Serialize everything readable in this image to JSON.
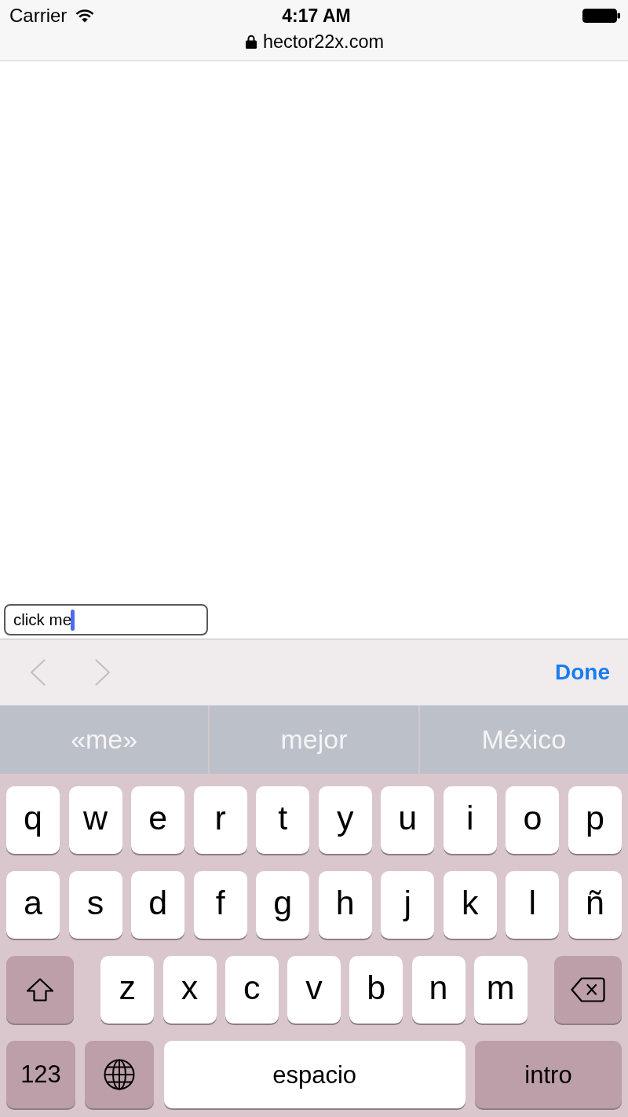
{
  "status_bar": {
    "carrier": "Carrier",
    "time": "4:17 AM"
  },
  "address_bar": {
    "secure": true,
    "url": "hector22x.com"
  },
  "page": {
    "text_field": {
      "value": "click me",
      "focused": true
    }
  },
  "form_toolbar": {
    "previous": {
      "disabled": true
    },
    "next": {
      "disabled": true
    },
    "done": "Done"
  },
  "suggestions": [
    {
      "text": "«me»"
    },
    {
      "text": "mejor"
    },
    {
      "text": "México"
    }
  ],
  "keyboard": {
    "rows": [
      {
        "keys": [
          {
            "kind": "letter",
            "label": "q"
          },
          {
            "kind": "letter",
            "label": "w"
          },
          {
            "kind": "letter",
            "label": "e"
          },
          {
            "kind": "letter",
            "label": "r"
          },
          {
            "kind": "letter",
            "label": "t"
          },
          {
            "kind": "letter",
            "label": "y"
          },
          {
            "kind": "letter",
            "label": "u"
          },
          {
            "kind": "letter",
            "label": "i"
          },
          {
            "kind": "letter",
            "label": "o"
          },
          {
            "kind": "letter",
            "label": "p"
          }
        ]
      },
      {
        "keys": [
          {
            "kind": "letter",
            "label": "a"
          },
          {
            "kind": "letter",
            "label": "s"
          },
          {
            "kind": "letter",
            "label": "d"
          },
          {
            "kind": "letter",
            "label": "f"
          },
          {
            "kind": "letter",
            "label": "g"
          },
          {
            "kind": "letter",
            "label": "h"
          },
          {
            "kind": "letter",
            "label": "j"
          },
          {
            "kind": "letter",
            "label": "k"
          },
          {
            "kind": "letter",
            "label": "l"
          },
          {
            "kind": "letter",
            "label": "ñ"
          }
        ]
      },
      {
        "keys": [
          {
            "kind": "shift",
            "on": false
          },
          {
            "kind": "letter",
            "label": "z"
          },
          {
            "kind": "letter",
            "label": "x"
          },
          {
            "kind": "letter",
            "label": "c"
          },
          {
            "kind": "letter",
            "label": "v"
          },
          {
            "kind": "letter",
            "label": "b"
          },
          {
            "kind": "letter",
            "label": "n"
          },
          {
            "kind": "letter",
            "label": "m"
          },
          {
            "kind": "delete"
          }
        ]
      },
      {
        "keys": [
          {
            "kind": "numbers",
            "label": "123"
          },
          {
            "kind": "globe"
          },
          {
            "kind": "space",
            "label": "espacio"
          },
          {
            "kind": "return",
            "label": "intro"
          }
        ]
      }
    ]
  }
}
